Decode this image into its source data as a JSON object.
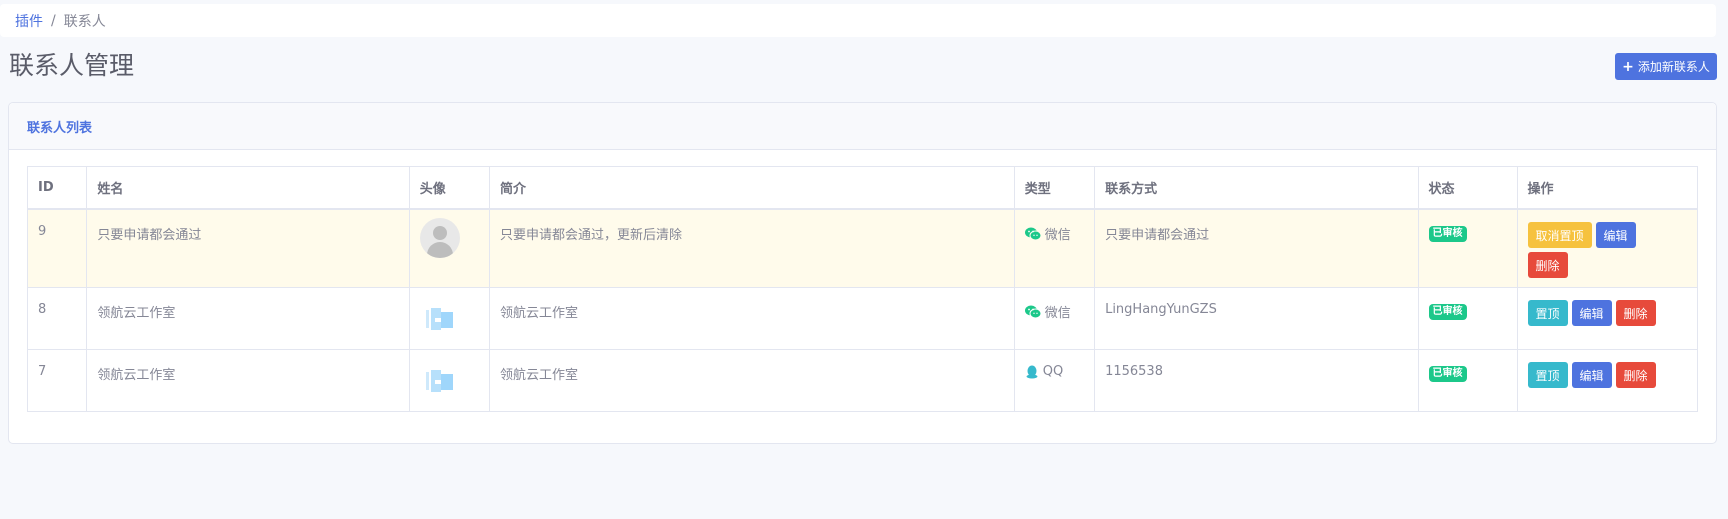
{
  "breadcrumb": {
    "root": "插件",
    "separator": "/",
    "current": "联系人"
  },
  "page": {
    "title": "联系人管理",
    "add_button": "添加新联系人"
  },
  "card": {
    "header": "联系人列表"
  },
  "table": {
    "columns": [
      "ID",
      "姓名",
      "头像",
      "简介",
      "类型",
      "联系方式",
      "状态",
      "操作"
    ],
    "rows": [
      {
        "id": "9",
        "name": "只要申请都会通过",
        "avatar": "default-avatar",
        "intro": "只要申请都会通过，更新后清除",
        "type": "微信",
        "type_icon": "wechat-icon",
        "contact": "只要申请都会通过",
        "status": "已审核",
        "actions": [
          "取消置顶",
          "编辑",
          "删除"
        ]
      },
      {
        "id": "8",
        "name": "领航云工作室",
        "avatar": "studio-logo",
        "intro": "领航云工作室",
        "type": "微信",
        "type_icon": "wechat-icon",
        "contact": "LingHangYunGZS",
        "status": "已审核",
        "actions": [
          "置顶",
          "编辑",
          "删除"
        ]
      },
      {
        "id": "7",
        "name": "领航云工作室",
        "avatar": "studio-logo",
        "intro": "领航云工作室",
        "type": "QQ",
        "type_icon": "qq-icon",
        "contact": "1156538",
        "status": "已审核",
        "actions": [
          "置顶",
          "编辑",
          "删除"
        ]
      }
    ]
  },
  "colors": {
    "primary": "#4e73df",
    "success": "#1cc88a",
    "warning": "#f6c23e",
    "danger": "#e74a3b",
    "info": "#36b9cc",
    "highlight_row": "#fffbeb"
  }
}
